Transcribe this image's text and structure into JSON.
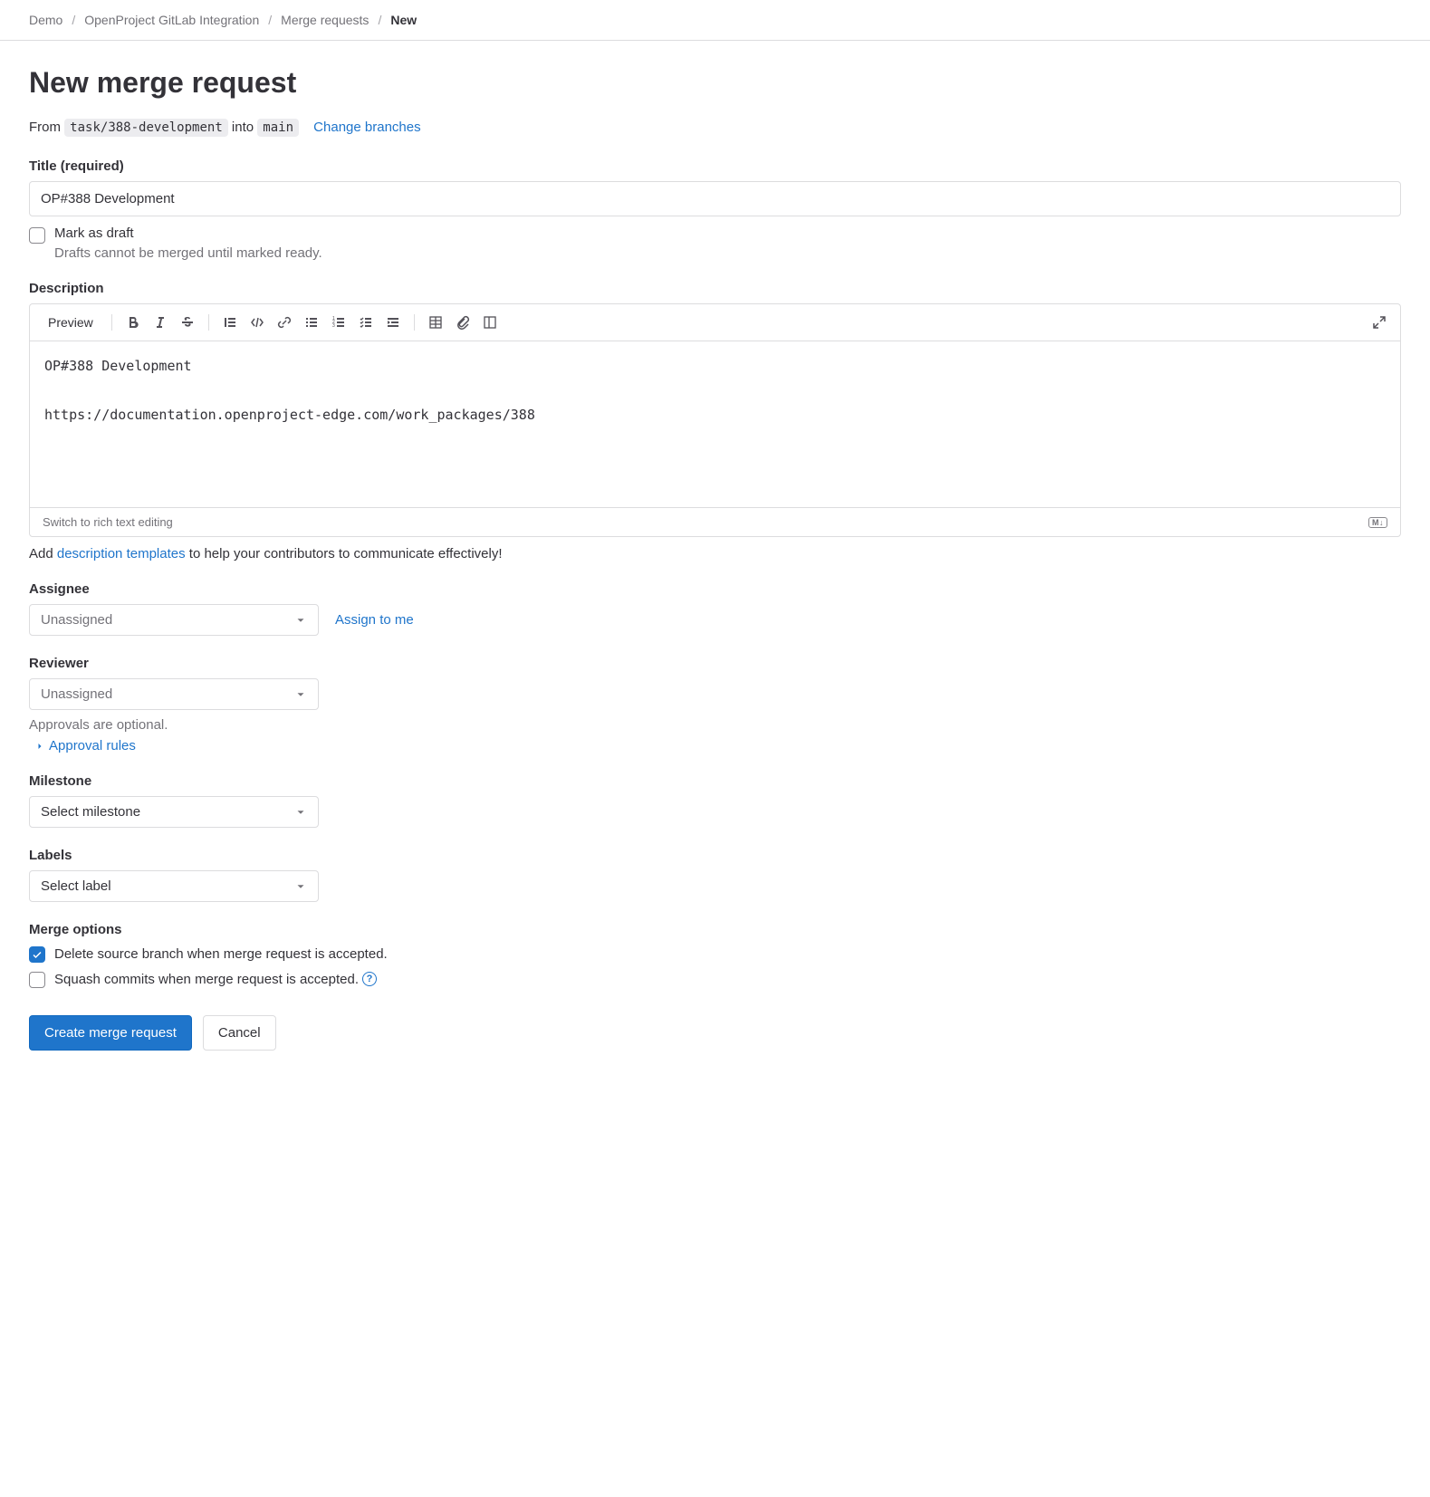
{
  "breadcrumb": {
    "items": [
      "Demo",
      "OpenProject GitLab Integration",
      "Merge requests"
    ],
    "current": "New"
  },
  "page_title": "New merge request",
  "branch": {
    "from_label": "From",
    "from_branch": "task/388-development",
    "into_label": "into",
    "into_branch": "main",
    "change_link": "Change branches"
  },
  "title_field": {
    "label": "Title (required)",
    "value": "OP#388 Development",
    "draft_label": "Mark as draft",
    "draft_hint": "Drafts cannot be merged until marked ready."
  },
  "description": {
    "label": "Description",
    "preview": "Preview",
    "body": "OP#388 Development\n\nhttps://documentation.openproject-edge.com/work_packages/388",
    "footer_link": "Switch to rich text editing",
    "md_badge": "M↓",
    "hint_prefix": "Add ",
    "hint_link": "description templates",
    "hint_suffix": " to help your contributors to communicate effectively!"
  },
  "assignee": {
    "label": "Assignee",
    "value": "Unassigned",
    "assign_me": "Assign to me"
  },
  "reviewer": {
    "label": "Reviewer",
    "value": "Unassigned",
    "optional": "Approvals are optional.",
    "rules_link": "Approval rules"
  },
  "milestone": {
    "label": "Milestone",
    "value": "Select milestone"
  },
  "labels": {
    "label": "Labels",
    "value": "Select label"
  },
  "merge_options": {
    "label": "Merge options",
    "delete_branch": "Delete source branch when merge request is accepted.",
    "squash": "Squash commits when merge request is accepted."
  },
  "actions": {
    "submit": "Create merge request",
    "cancel": "Cancel"
  }
}
